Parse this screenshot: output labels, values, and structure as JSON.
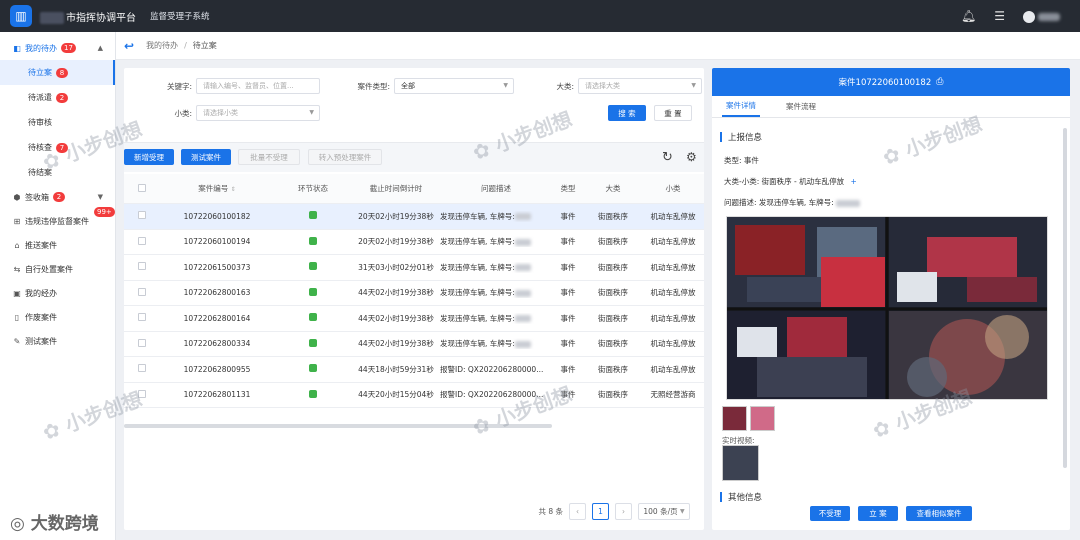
{
  "app": {
    "title": "市指挥协调平台",
    "subsystem": "监督受理子系统"
  },
  "sidebar": {
    "items": [
      {
        "label": "我的待办",
        "badge": "17",
        "icon": "todo-icon"
      },
      {
        "label": "待立案",
        "badge": "8"
      },
      {
        "label": "待派遣",
        "badge": "2"
      },
      {
        "label": "待审核",
        "badge": ""
      },
      {
        "label": "待核查",
        "badge": "7"
      },
      {
        "label": "待结案",
        "badge": ""
      },
      {
        "label": "签收箱",
        "badge": "2",
        "icon": "inbox-icon"
      },
      {
        "label": "违规违停监督案件",
        "badge": "99+",
        "icon": "grid-icon"
      },
      {
        "label": "推送案件",
        "badge": "",
        "icon": "push-icon"
      },
      {
        "label": "自行处置案件",
        "badge": "",
        "icon": "self-handle-icon"
      },
      {
        "label": "我的经办",
        "badge": "",
        "icon": "calendar-icon"
      },
      {
        "label": "作废案件",
        "badge": "",
        "icon": "bookmark-icon"
      },
      {
        "label": "测试案件",
        "badge": "",
        "icon": "test-icon"
      }
    ]
  },
  "breadcrumb": {
    "parent": "我的待办",
    "separator": "/",
    "current": "待立案"
  },
  "filters": {
    "keyword_label": "关键字:",
    "keyword_placeholder": "请输入编号、监督员、位置...",
    "case_type_label": "案件类型:",
    "case_type_value": "全部",
    "major_label": "大类:",
    "major_placeholder": "请选择大类",
    "minor_label": "小类:",
    "minor_placeholder": "请选择小类",
    "search_button": "搜 索",
    "reset_button": "重 置"
  },
  "toolbar": {
    "buttons": [
      "新增受理",
      "测试案件",
      "批量不受理",
      "转入预处理案件"
    ]
  },
  "table": {
    "headers": [
      "案件编号",
      "环节状态",
      "截止时间倒计时",
      "问题描述",
      "类型",
      "大类",
      "小类"
    ],
    "rows": [
      {
        "id": "10722060100182",
        "deadline": "20天02小时19分38秒",
        "desc": "发现违停车辆, 车牌号:",
        "type": "事件",
        "major": "街面秩序",
        "minor": "机动车乱停放"
      },
      {
        "id": "10722060100194",
        "deadline": "20天02小时19分38秒",
        "desc": "发现违停车辆, 车牌号:",
        "type": "事件",
        "major": "街面秩序",
        "minor": "机动车乱停放"
      },
      {
        "id": "10722061500373",
        "deadline": "31天03小时02分01秒",
        "desc": "发现违停车辆, 车牌号:",
        "type": "事件",
        "major": "街面秩序",
        "minor": "机动车乱停放"
      },
      {
        "id": "10722062800163",
        "deadline": "44天02小时19分38秒",
        "desc": "发现违停车辆, 车牌号:",
        "type": "事件",
        "major": "街面秩序",
        "minor": "机动车乱停放"
      },
      {
        "id": "10722062800164",
        "deadline": "44天02小时19分38秒",
        "desc": "发现违停车辆, 车牌号:",
        "type": "事件",
        "major": "街面秩序",
        "minor": "机动车乱停放"
      },
      {
        "id": "10722062800334",
        "deadline": "44天02小时19分38秒",
        "desc": "发现违停车辆, 车牌号:",
        "type": "事件",
        "major": "街面秩序",
        "minor": "机动车乱停放"
      },
      {
        "id": "10722062800955",
        "deadline": "44天18小时59分31秒",
        "desc": "报警ID: QX202206280000...",
        "type": "事件",
        "major": "街面秩序",
        "minor": "机动车乱停放"
      },
      {
        "id": "10722062801131",
        "deadline": "44天20小时15分04秒",
        "desc": "报警ID: QX202206280000...",
        "type": "事件",
        "major": "街面秩序",
        "minor": "无照经营游商"
      }
    ]
  },
  "pager": {
    "total": "共 8 条",
    "current_page": "1",
    "page_size": "100 条/页"
  },
  "panel": {
    "header": "案件10722060100182",
    "tabs": [
      "案件详情",
      "案件流程"
    ],
    "section_report": "上报信息",
    "type_line": "类型: 事件",
    "category_line": "大类-小类: 街面秩序 - 机动车乱停放",
    "desc_line": "问题描述: 发现违停车辆, 车牌号:",
    "realtime_label": "实时视频:",
    "section_other": "其他信息",
    "buttons": [
      "不受理",
      "立 案",
      "查看相似案件"
    ]
  },
  "watermark": {
    "text": "小步创想",
    "corner": "大数跨境"
  },
  "colors": {
    "accent": "#1a73e8",
    "topbar": "#262b33",
    "badge": "#f23c3c",
    "status": "#3fb24a"
  }
}
